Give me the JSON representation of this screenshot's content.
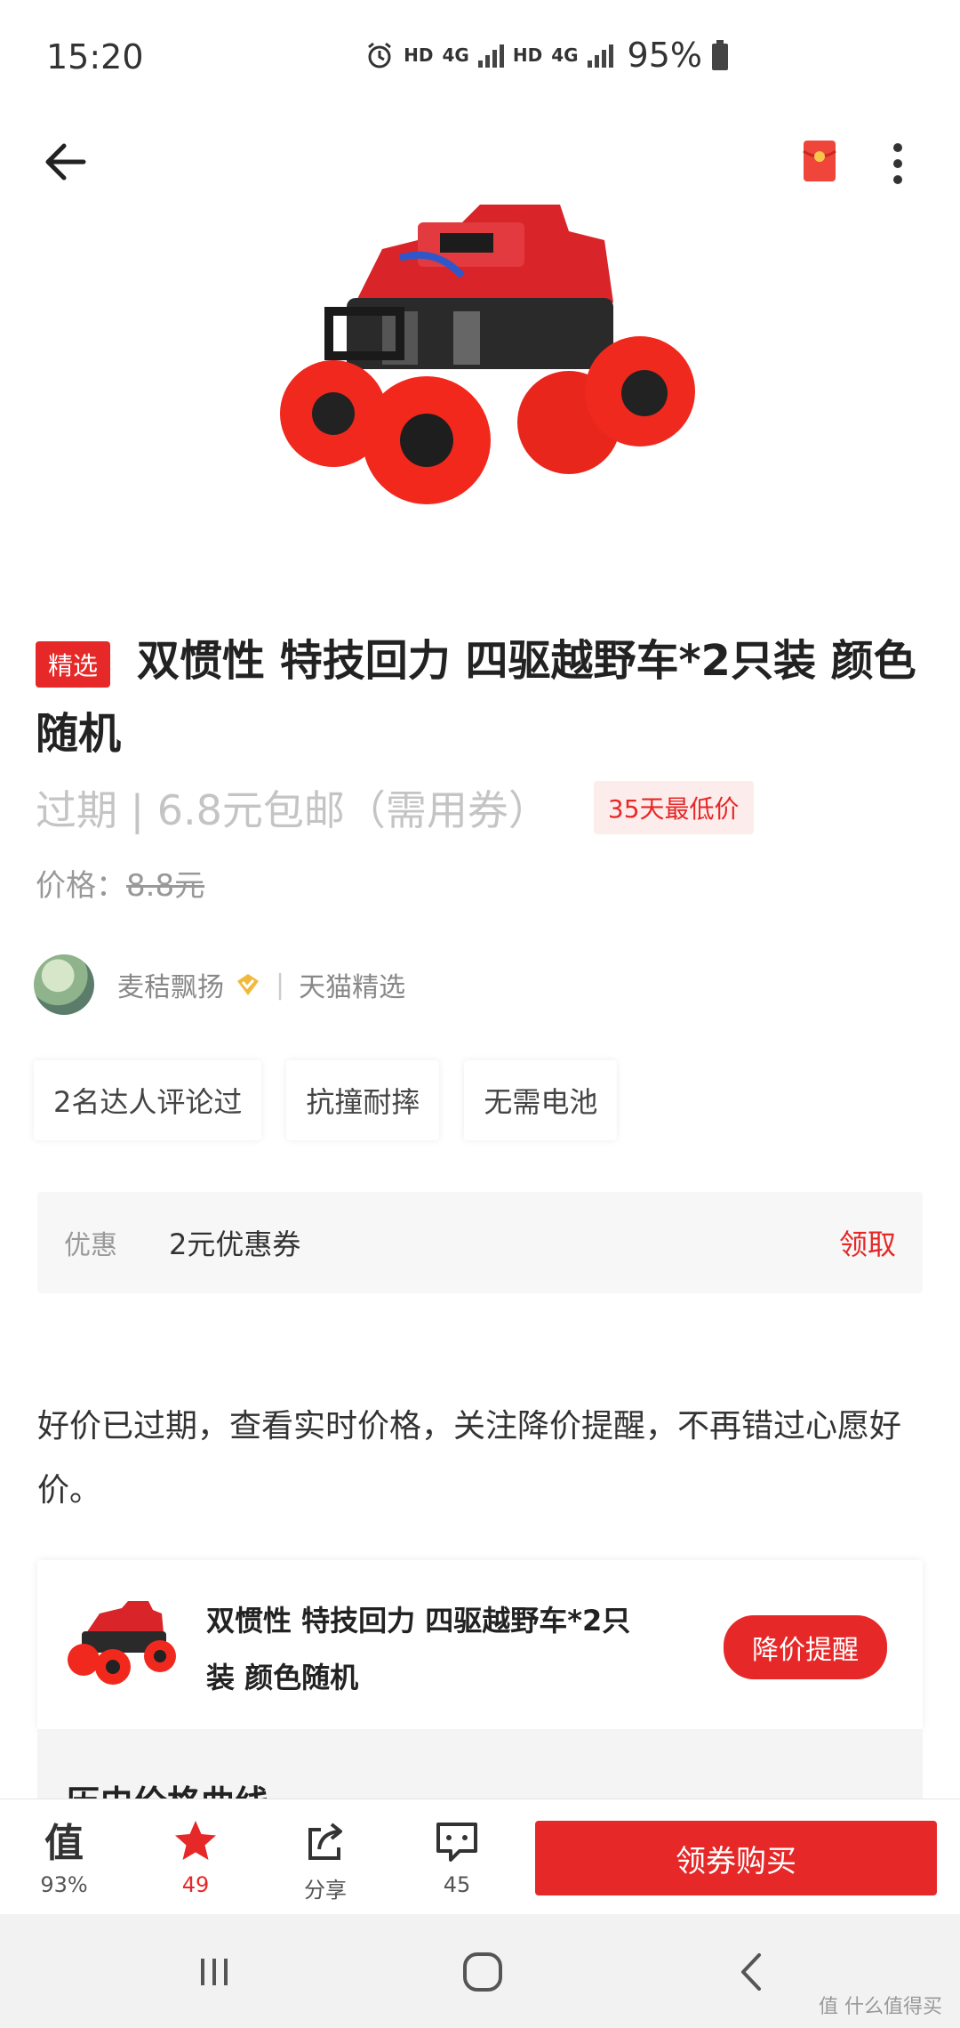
{
  "status": {
    "time": "15:20",
    "hd": "HD",
    "net": "4G",
    "battery": "95%"
  },
  "product": {
    "tag": "精选",
    "title": "双惯性 特技回力 四驱越野车*2只装 颜色随机",
    "price_line": "过期 | 6.8元包邮（需用券）",
    "lowest_badge": "35天最低价",
    "orig_label": "价格：",
    "orig_value": "8.8元"
  },
  "author": {
    "name": "麦秸飘扬",
    "divider": "|",
    "source": "天猫精选"
  },
  "features": [
    "2名达人评论过",
    "抗撞耐摔",
    "无需电池"
  ],
  "coupon": {
    "label": "优惠",
    "value": "2元优惠券",
    "action": "领取"
  },
  "description": "好价已过期，查看实时价格，关注降价提醒，不再错过心愿好价。",
  "card": {
    "title": "双惯性 特技回力 四驱越野车*2只装 颜色随机",
    "button": "降价提醒"
  },
  "history": {
    "title": "历史价格曲线"
  },
  "bottom_bar": {
    "worth_icon_char": "值",
    "worth_label": "93%",
    "fav_label": "49",
    "share_label": "分享",
    "comment_label": "45",
    "buy_button": "领券购买"
  },
  "watermark": "值 什么值得买",
  "colors": {
    "accent": "#e62828",
    "badge_bg": "#fdecec"
  }
}
